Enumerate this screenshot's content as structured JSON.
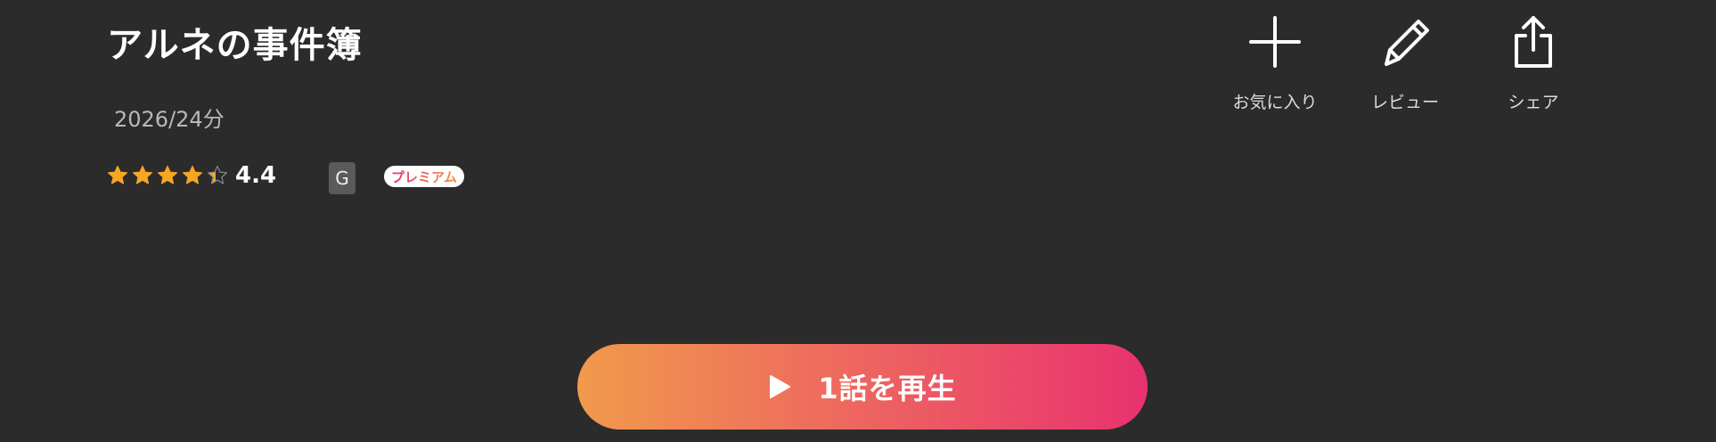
{
  "title": "アルネの事件簿",
  "meta": "2026/24分",
  "rating": {
    "value_text": "4.4",
    "value": 4.4,
    "max": 5,
    "star_color": "#f5a623"
  },
  "age_rating": "G",
  "premium_label": "プレミアム",
  "actions": {
    "favorite": "お気に入り",
    "review": "レビュー",
    "share": "シェア"
  },
  "play_button": {
    "label": "1話を再生",
    "gradient_start": "#f19a4c",
    "gradient_end": "#e8326f"
  },
  "icons": [
    "plus-icon",
    "pencil-icon",
    "share-icon",
    "play-icon",
    "star-icon"
  ]
}
